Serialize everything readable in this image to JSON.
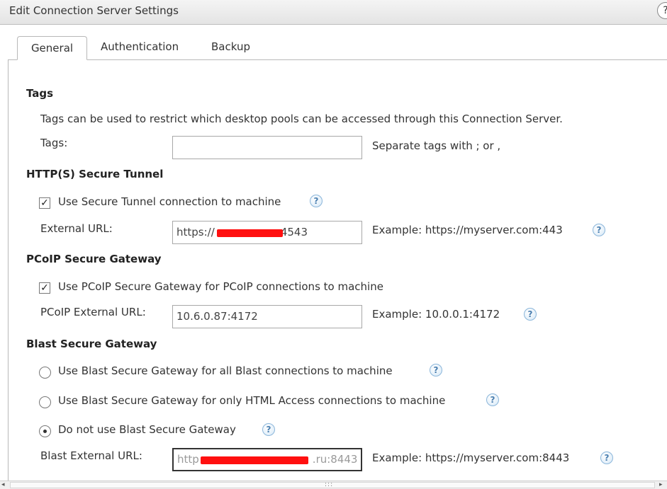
{
  "window": {
    "title": "Edit Connection Server Settings",
    "help_glyph": "?"
  },
  "tabs": [
    {
      "label": "General",
      "active": true
    },
    {
      "label": "Authentication",
      "active": false
    },
    {
      "label": "Backup",
      "active": false
    }
  ],
  "tags": {
    "heading": "Tags",
    "description": "Tags can be used to restrict which desktop pools can be accessed through this Connection Server.",
    "label": "Tags:",
    "value": "",
    "hint": "Separate tags with ; or ,"
  },
  "secure_tunnel": {
    "heading": "HTTP(S) Secure Tunnel",
    "checkbox_label": "Use Secure Tunnel connection to machine",
    "checked": true,
    "url_label": "External URL:",
    "url_prefix": "https://",
    "url_suffix": ":4543",
    "example": "Example: https://myserver.com:443"
  },
  "pcoip": {
    "heading": "PCoIP Secure Gateway",
    "checkbox_label": "Use PCoIP Secure Gateway for PCoIP connections to machine",
    "checked": true,
    "url_label": "PCoIP External URL:",
    "url_value": "10.6.0.87:4172",
    "example": "Example: 10.0.0.1:4172"
  },
  "blast": {
    "heading": "Blast Secure Gateway",
    "option_all": "Use Blast Secure Gateway for all Blast connections to machine",
    "option_html": "Use Blast Secure Gateway for only HTML Access connections to machine",
    "option_none": "Do not use Blast Secure Gateway",
    "selected": "none",
    "url_label": "Blast External URL:",
    "url_prefix": "http",
    "url_suffix": ".ru:8443",
    "example": "Example: https://myserver.com:8443"
  },
  "checkmark_glyph": "✓",
  "help_icon_glyph": "?",
  "scrollbar": {
    "left_arrow": "◂",
    "right_arrow": "▸",
    "grip": ":::"
  },
  "colors": {
    "redaction": "#ff1010",
    "help_icon": "#4a7fb0"
  }
}
